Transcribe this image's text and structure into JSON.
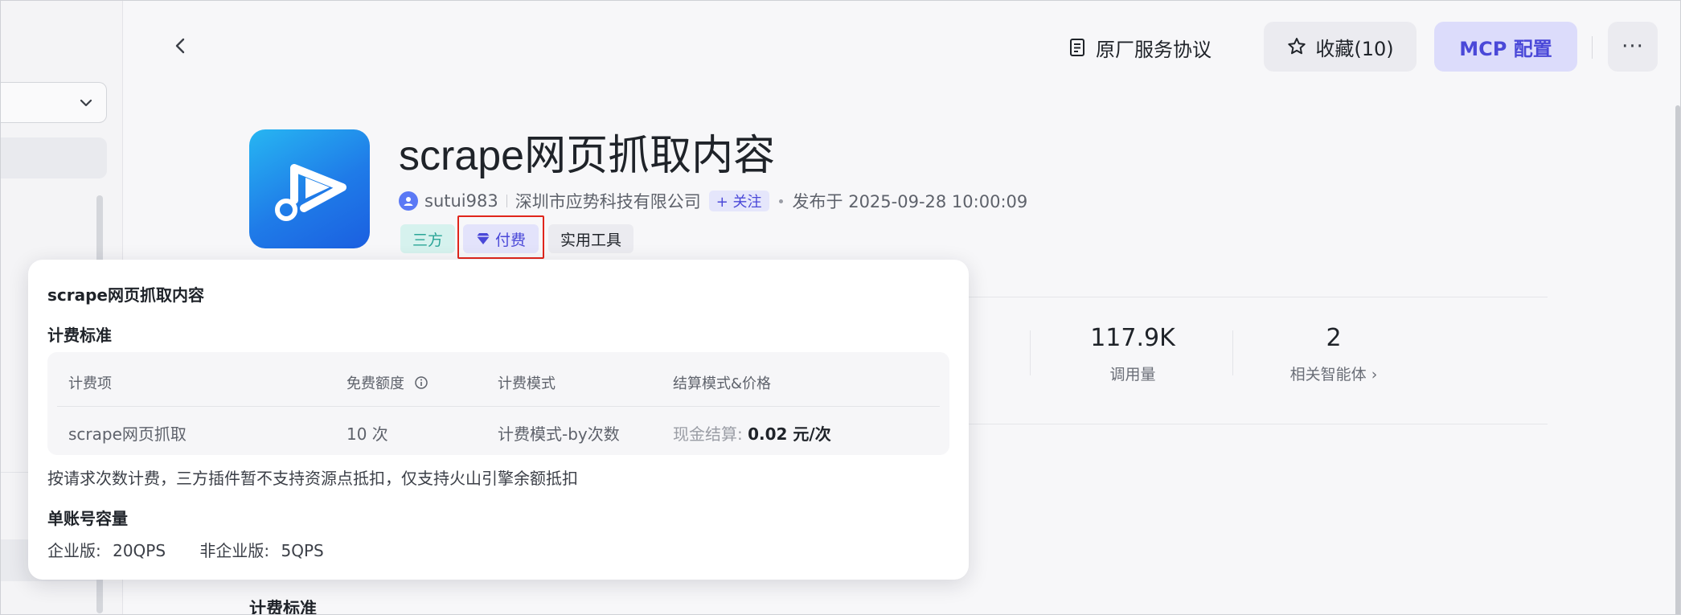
{
  "sidebar": {},
  "header": {
    "agreement_label": "原厂服务协议",
    "favorite_label": "收藏(10)",
    "mcp_label": "MCP 配置",
    "more_label": "···"
  },
  "plugin": {
    "title": "scrape网页抓取内容",
    "author": "sutui983",
    "company": "深圳市应势科技有限公司",
    "follow_label": "+ 关注",
    "published": "发布于 2025-09-28 10:00:09",
    "tags": {
      "third_party": "三方",
      "paid": "付费",
      "tool": "实用工具"
    },
    "logo_colors": [
      "#27b6f2",
      "#1b5fe0"
    ]
  },
  "stats": [
    {
      "value": "117.9K",
      "label": "调用量"
    },
    {
      "value": "2",
      "label": "相关智能体 ›"
    }
  ],
  "section_heading": "计费标准",
  "popover": {
    "title": "scrape网页抓取内容",
    "billing_heading": "计费标准",
    "table": {
      "headers": [
        "计费项",
        "免费额度",
        "计费模式",
        "结算模式&价格"
      ],
      "row": {
        "item": "scrape网页抓取",
        "free_quota": "10 次",
        "mode": "计费模式-by次数",
        "price_label": "现金结算:",
        "price_value": "0.02 元/次"
      }
    },
    "note": "按请求次数计费，三方插件暂不支持资源点抵扣，仅支持火山引擎余额抵扣",
    "capacity_heading": "单账号容量",
    "enterprise_label": "企业版:",
    "enterprise_value": "20QPS",
    "non_enterprise_label": "非企业版:",
    "non_enterprise_value": "5QPS"
  },
  "colors": {
    "accent": "#4a48d8",
    "highlight_box": "#e0251b",
    "tag_green": "#2aa597"
  }
}
